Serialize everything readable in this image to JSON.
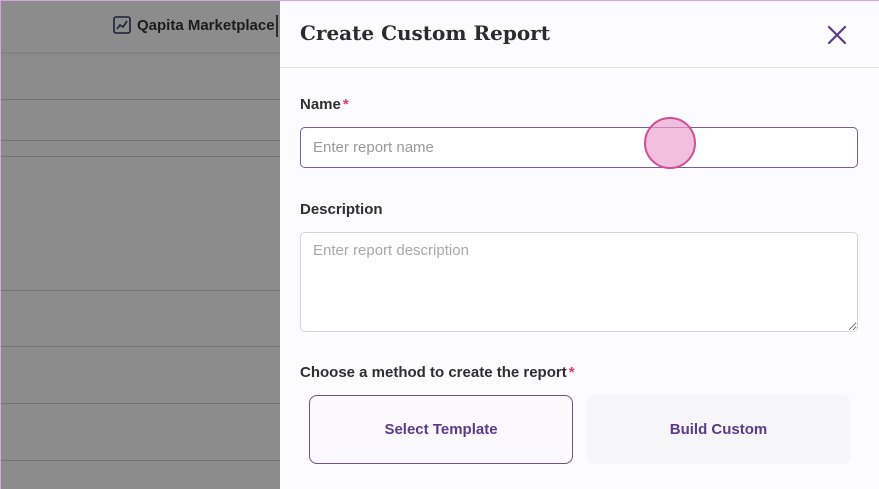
{
  "background_app": {
    "brand_name": "Qapita Marketplace",
    "brand_icon": "chart-icon"
  },
  "drawer": {
    "title": "Create Custom Report",
    "close_icon": "close-icon",
    "name": {
      "label": "Name",
      "required_mark": "*",
      "value": "",
      "placeholder": "Enter report name"
    },
    "description": {
      "label": "Description",
      "value": "",
      "placeholder": "Enter report description"
    },
    "method": {
      "label": "Choose a method to create the report",
      "required_mark": "*",
      "options": [
        "Select Template",
        "Build Custom"
      ],
      "selected": "Select Template"
    }
  },
  "colors": {
    "accent": "#5b3a8a",
    "required": "#d63b6e",
    "input_border_focus": "#7a5c9c",
    "click_indicator": "#cc4f98"
  }
}
